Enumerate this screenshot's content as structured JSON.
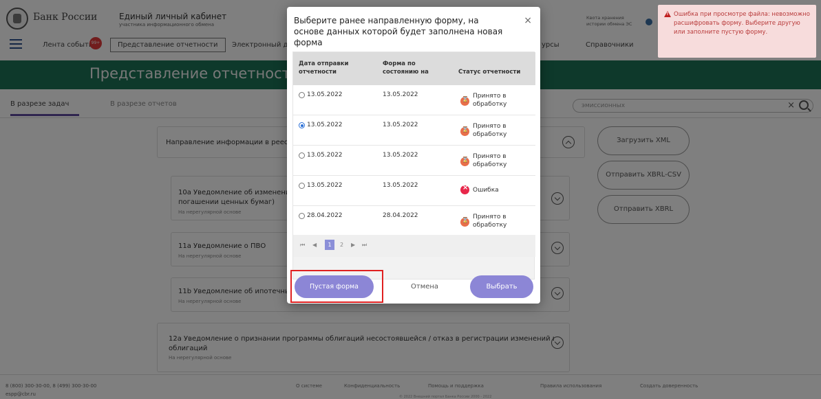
{
  "header": {
    "logo_text": "Банк России",
    "cabinet_title": "Единый личный кабинет",
    "cabinet_subtitle": "участника информационного обмена",
    "quota_text": "Квота хранения истории обмена ЭС"
  },
  "nav": {
    "events_label": "Лента событий",
    "events_badge": "99+",
    "report_label": "Представление отчетности",
    "edo_label": "Электронный док",
    "resources_label": "урсы",
    "refs_label": "Справочники"
  },
  "banner": {
    "title": "Представление отчетности"
  },
  "tabs": {
    "tasks": "В разрезе задач",
    "reports": "В разрезе отчетов"
  },
  "search": {
    "placeholder": "эмиссионных"
  },
  "cards": [
    {
      "title": "Направление информации в реестр эм",
      "sub": ""
    },
    {
      "title": "10а Уведомление об изменении св",
      "title2": "погашении ценных бумаг)",
      "sub": "На нерегулярной основе"
    },
    {
      "title": "11а Уведомление о ПВО",
      "sub": "На нерегулярной основе"
    },
    {
      "title": "11b Уведомление об ипотечных ка",
      "sub": "На нерегулярной основе"
    },
    {
      "title": "12а Уведомление о признании программы облигаций несостоявшейся / отказ в регистрации изменений в программу",
      "title2": "облигаций",
      "sub": "На нерегулярной основе"
    }
  ],
  "side_buttons": {
    "upload_xml": "Загрузить XML",
    "send_xbrl_csv": "Отправить XBRL-CSV",
    "send_xbrl": "Отправить XBRL"
  },
  "footer": {
    "phone": "8 (800) 300-30-00, 8 (499) 300-30-00",
    "email": "espp@cbr.ru",
    "about": "О системе",
    "privacy": "Конфиденциальность",
    "help": "Помощь и поддержка",
    "rules": "Правила использования",
    "power": "Создать доверенность",
    "copyright": "© 2022 Внешний портал Банка России 2000 - 2022"
  },
  "modal": {
    "title": "Выберите ранее направленную форму, на основе данных которой будет заполнена новая форма",
    "close_icon": "close-icon",
    "columns": {
      "date": "Дата отправки отчетности",
      "form": "Форма по состоянию на",
      "status": "Статус отчетности"
    },
    "rows": [
      {
        "date": "13.05.2022",
        "form": "13.05.2022",
        "status": "Принято в обработку",
        "state": "ok",
        "checked": false
      },
      {
        "date": "13.05.2022",
        "form": "13.05.2022",
        "status": "Принято в обработку",
        "state": "ok",
        "checked": true
      },
      {
        "date": "13.05.2022",
        "form": "13.05.2022",
        "status": "Принято в обработку",
        "state": "ok",
        "checked": false
      },
      {
        "date": "13.05.2022",
        "form": "13.05.2022",
        "status": "Ошибка",
        "state": "err",
        "checked": false
      },
      {
        "date": "28.04.2022",
        "form": "28.04.2022",
        "status": "Принято в обработку",
        "state": "ok",
        "checked": false
      }
    ],
    "pager": {
      "first": "⏮",
      "prev": "◀",
      "page1": "1",
      "page2": "2",
      "next": "▶",
      "last": "⏭"
    },
    "buttons": {
      "empty": "Пустая форма",
      "cancel": "Отмена",
      "select": "Выбрать"
    }
  },
  "toast": {
    "text": "Ошибка при просмотре файла: невозможно расшифровать форму. Выберите другую или заполните пустую форму."
  },
  "colors": {
    "banner": "#1d7256",
    "accent": "#8c86d6",
    "error": "#c02020",
    "toast_bg": "#f7dcdc"
  }
}
